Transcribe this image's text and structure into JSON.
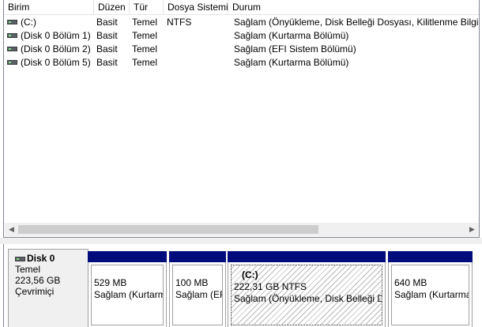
{
  "columns": [
    "Birim",
    "Düzen",
    "Tür",
    "Dosya Sistemi",
    "Durum"
  ],
  "volumes": [
    {
      "name": "(C:)",
      "layout": "Basit",
      "type": "Temel",
      "fs": "NTFS",
      "status": "Sağlam (Önyükleme, Disk Belleği Dosyası, Kilitlenme Bilgisi"
    },
    {
      "name": "(Disk 0 Bölüm 1)",
      "layout": "Basit",
      "type": "Temel",
      "fs": "",
      "status": "Sağlam (Kurtarma Bölümü)"
    },
    {
      "name": "(Disk 0 Bölüm 2)",
      "layout": "Basit",
      "type": "Temel",
      "fs": "",
      "status": "Sağlam (EFI Sistem Bölümü)"
    },
    {
      "name": "(Disk 0 Bölüm 5)",
      "layout": "Basit",
      "type": "Temel",
      "fs": "",
      "status": "Sağlam (Kurtarma Bölümü)"
    }
  ],
  "scrollbar": {
    "left_arrow": "◀",
    "right_arrow": "▶"
  },
  "disk": {
    "name": "Disk 0",
    "kind": "Temel",
    "size": "223,56 GB",
    "state": "Çevrimiçi"
  },
  "partitions": [
    {
      "size": "529 MB",
      "status": "Sağlam (Kurtarma Bölümü)"
    },
    {
      "size": "100 MB",
      "status": "Sağlam (EFI Sistem Bölümü)"
    },
    {
      "label": "(C:)",
      "size": "222,31 GB NTFS",
      "status": "Sağlam (Önyükleme, Disk Belleği Dosyası"
    },
    {
      "size": "640 MB",
      "status": "Sağlam (Kurtarma Bölümü)"
    }
  ],
  "colors": {
    "partition_bar": "#000c7c",
    "selection_hatch": "#b8b8b8"
  }
}
